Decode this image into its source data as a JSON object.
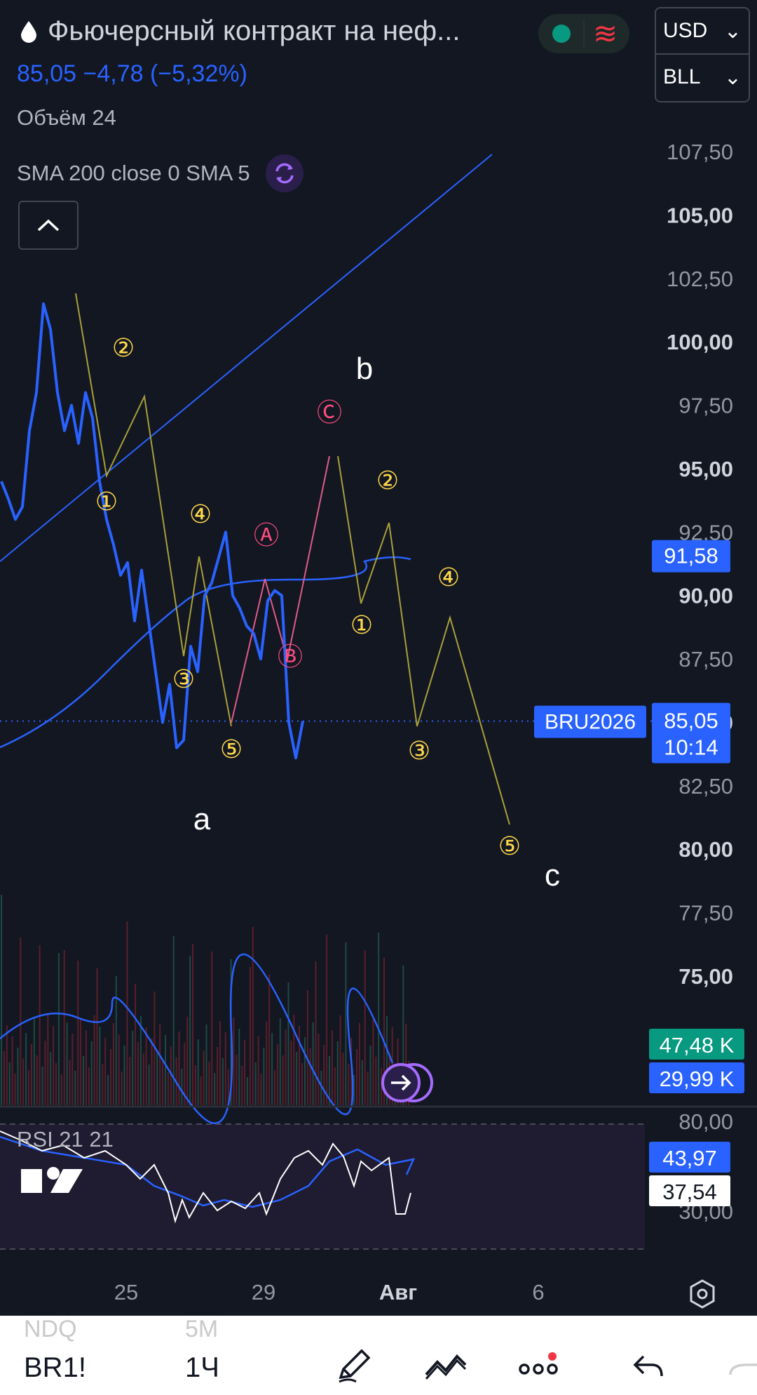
{
  "header": {
    "title": "Фьючерсный контракт на неф...",
    "price_line": "85,05  −4,78 (−5,32%)",
    "volume_label": "Объём 24",
    "indicator_label": "SMA 200 close 0 SMA 5",
    "currency": "USD",
    "unit": "BLL"
  },
  "chart_data": [
    {
      "type": "line",
      "title": "",
      "price_axis": [
        "107,50",
        "105,00",
        "102,50",
        "100,00",
        "97,50",
        "95,00",
        "92,50",
        "90,00",
        "87,50",
        "85,00",
        "82,50",
        "80,00",
        "77,50",
        "75,00"
      ],
      "ylim": [
        73.5,
        109
      ],
      "time_axis": [
        "25",
        "29",
        "Авг",
        "6"
      ],
      "series": [
        {
          "name": "",
          "x": [
            0,
            0.2,
            0.4,
            0.6,
            0.8,
            1.0,
            1.2,
            1.4,
            1.6,
            1.8,
            2.0,
            2.2,
            2.4,
            2.6,
            2.8,
            3.0,
            3.2,
            3.4,
            3.6,
            3.8,
            4.0,
            4.2,
            4.4,
            4.6,
            4.8,
            5.0,
            5.2,
            5.4,
            5.6,
            5.8,
            6.0,
            6.2,
            6.4,
            6.6,
            6.8,
            7.0,
            7.2,
            7.4,
            7.6,
            7.8,
            8.0,
            8.2,
            8.4,
            8.6,
            8.8,
            9.0,
            9.2,
            9.4,
            9.6,
            9.8,
            10.0,
            10.2,
            10.4,
            10.6,
            10.8,
            11.0,
            11.2,
            11.4,
            11.6,
            11.8
          ],
          "values": [
            94.5,
            93.8,
            93.0,
            93.5,
            96.5,
            98.0,
            101.5,
            100.5,
            98.0,
            96.5,
            97.5,
            96.0,
            98.0,
            97.0,
            94.5,
            93.0,
            92.0,
            90.8,
            91.3,
            89.0,
            91.0,
            89.0,
            87.0,
            85.0,
            86.5,
            84.0,
            84.3,
            88.0,
            87.0,
            90.0,
            90.5,
            91.5,
            92.5,
            90.0,
            89.5,
            88.8,
            88.5,
            87.5,
            89.8,
            90.2,
            90.0,
            85.0,
            83.6,
            85.05,
            null,
            null,
            null,
            null,
            null,
            null,
            null,
            null,
            null,
            null,
            null,
            null,
            null,
            null,
            null,
            null
          ]
        },
        {
          "name": "",
          "x": [
            0,
            1,
            2,
            3,
            4,
            5,
            6,
            7,
            8,
            9,
            10,
            11,
            12
          ],
          "values": [
            null,
            null,
            null,
            null,
            null,
            null,
            null,
            null,
            null,
            null,
            null,
            null,
            null
          ]
        }
      ],
      "price_tags": [
        {
          "text": "91,58",
          "value": 91.58,
          "color": "#2962ff"
        },
        {
          "text": "85,05",
          "sub": "10:14",
          "value": 85.05,
          "color": "#2962ff"
        }
      ],
      "symbol_tag": "BRU2026",
      "wave_labels": [
        {
          "text": "a",
          "color": "#ffffff"
        },
        {
          "text": "b",
          "color": "#ffffff"
        },
        {
          "text": "c",
          "color": "#ffffff"
        }
      ],
      "circle_labels": [
        "①",
        "②",
        "③",
        "④",
        "⑤",
        "Ⓐ",
        "Ⓑ",
        "Ⓒ"
      ]
    },
    {
      "type": "bar",
      "title": "",
      "volume_tags": [
        {
          "text": "47,48 K",
          "color": "#089981"
        },
        {
          "text": "29,99 K",
          "color": "#2962ff"
        }
      ]
    },
    {
      "type": "line",
      "title": "RSI 21 21",
      "axis": [
        "80,00",
        "30,00"
      ],
      "tags": [
        {
          "text": "43,97",
          "color": "#2962ff"
        },
        {
          "text": "37,54",
          "color": "#ffffff"
        }
      ]
    }
  ],
  "time_axis": [
    "25",
    "29",
    "Авг",
    "6"
  ],
  "bottom_bar": {
    "ghost_left": "NDQ",
    "ghost_mid": "5M",
    "symbol": "BR1!",
    "timeframe": "1Ч"
  },
  "icons": [
    "drop-icon",
    "sync-icon",
    "chevron-up-icon",
    "gear-icon",
    "pencil-icon",
    "wave-tool-icon",
    "more-icon",
    "undo-icon",
    "redo-icon",
    "logo-icon",
    "replay-icon"
  ]
}
